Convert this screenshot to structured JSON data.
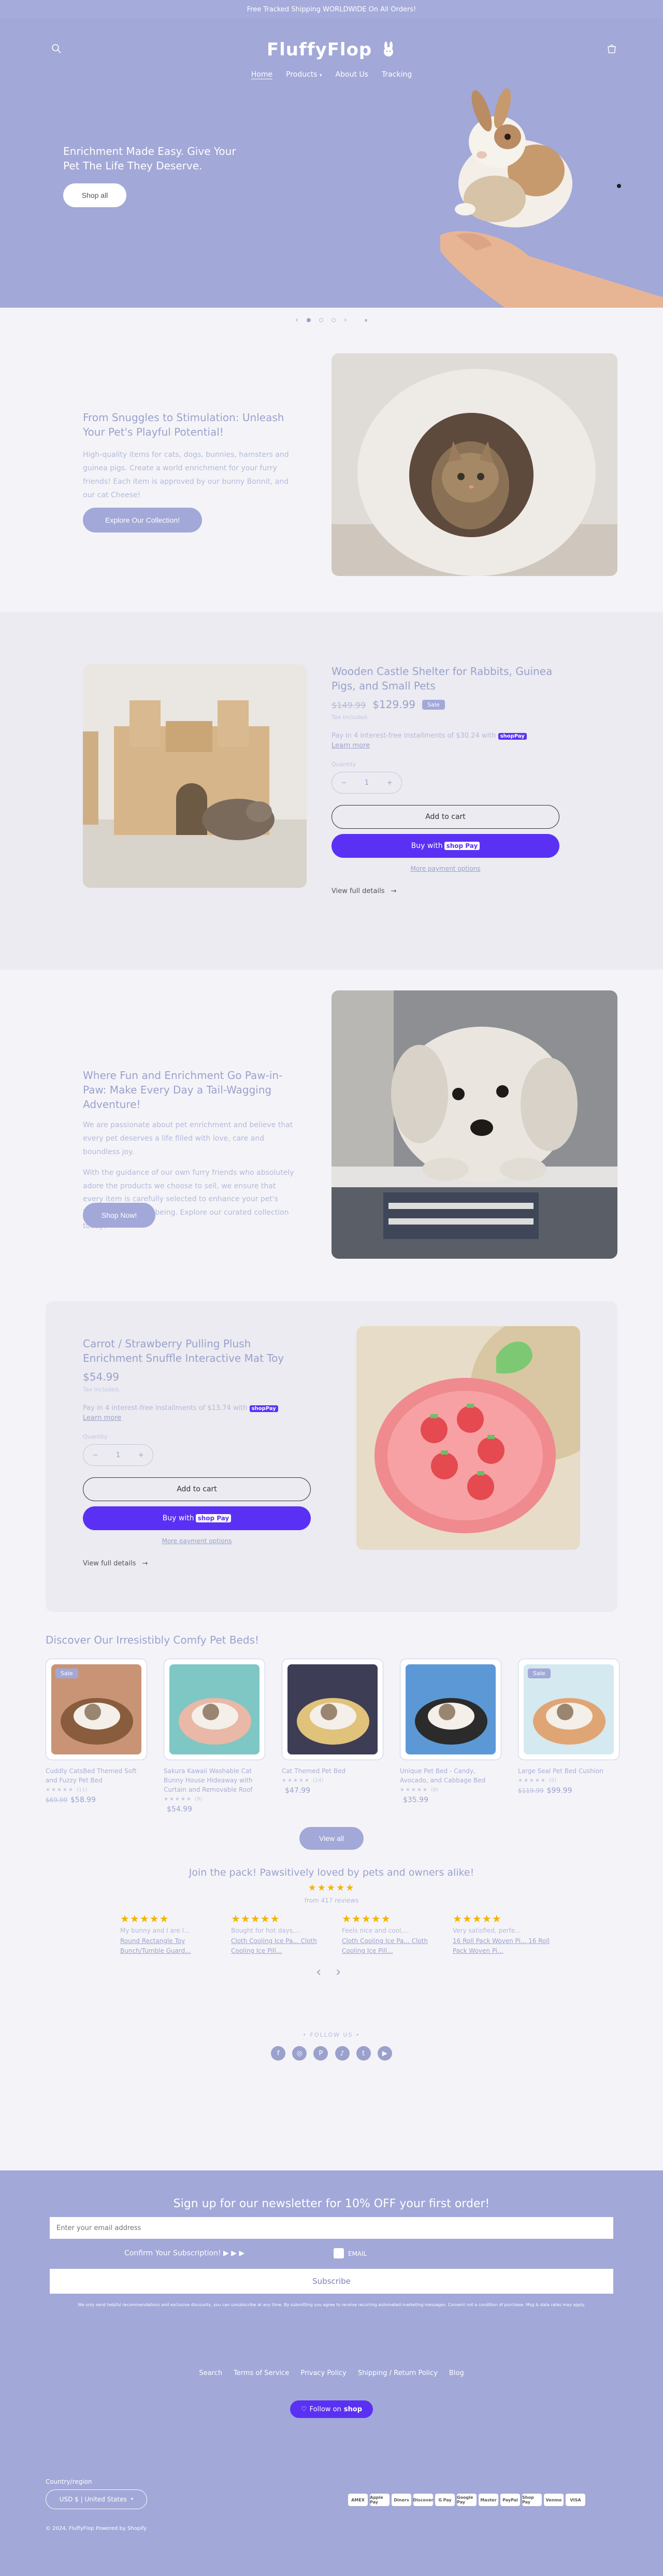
{
  "announcement": "Free Tracked Shipping WORLDWIDE On All Orders!",
  "brand": "FluffyFlop",
  "nav": [
    "Home",
    "Products",
    "About Us",
    "Tracking"
  ],
  "hero": {
    "heading": "Enrichment Made Easy. Give Your Pet The Life They Deserve.",
    "cta": "Shop all"
  },
  "slider": {
    "prev": "‹",
    "next": "›",
    "pause": "⏸"
  },
  "intro": {
    "heading": "From Snuggles to Stimulation: Unleash Your Pet's Playful Potential!",
    "body": "High-quality items for cats, dogs, bunnies, hamsters and guinea pigs. Create a world enrichment for your furry friends! Each item is approved by our bunny Bonnit, and our cat Cheese!",
    "cta": "Explore Our Collection!"
  },
  "featured1": {
    "title": "Wooden Castle Shelter for Rabbits, Guinea Pigs, and Small Pets",
    "price_old": "$149.99",
    "price": "$129.99",
    "badge": "Sale",
    "tax": "Tax included.",
    "installments": "Pay in 4 interest-free installments of $30.24 with",
    "learn": "Learn more",
    "qty_label": "Quantity",
    "qty": "1",
    "minus": "−",
    "plus": "+",
    "add": "Add to cart",
    "buy": "Buy with",
    "shop_pay": "shop Pay",
    "more": "More payment options",
    "details": "View full details"
  },
  "about": {
    "heading": "Where Fun and Enrichment Go Paw-in-Paw: Make Every Day a Tail-Wagging Adventure!",
    "p1": "We are passionate about pet enrichment and believe that every pet deserves a life filled with love, care and boundless joy.",
    "p2": "With the guidance of our own furry friends who absolutely adore the products we choose to sell, we ensure that every item is carefully selected to enhance your pet's happiness and well-being. Explore our curated collection today!",
    "cta": "Shop Now!"
  },
  "featured2": {
    "title": "Carrot / Strawberry Pulling Plush Enrichment Snuffle Interactive Mat Toy",
    "price": "$54.99",
    "tax": "Tax included.",
    "installments": "Pay in 4 interest-free installments of $13.74 with",
    "learn": "Learn more",
    "qty_label": "Quantity",
    "qty": "1",
    "minus": "−",
    "plus": "+",
    "add": "Add to cart",
    "buy": "Buy with",
    "shop_pay": "shop Pay",
    "more": "More payment options",
    "details": "View full details"
  },
  "collection": {
    "heading": "Discover Our Irresistibly Comfy Pet Beds!",
    "view_all": "View all",
    "products": [
      {
        "title": "Cuddly CatsBed Themed Soft and Fuzzy Pet Bed",
        "stars": "★★★★★",
        "count": "(11)",
        "price_old": "$69.99",
        "price": "$58.99",
        "badge": "Sale"
      },
      {
        "title": "Sakura Kawaii Washable Cat Bunny House Hideaway with Curtain and Removable Roof",
        "stars": "★★★★★",
        "count": "(9)",
        "price_old": "",
        "price": "$54.99",
        "badge": ""
      },
      {
        "title": "Cat Themed Pet Bed",
        "stars": "★★★★★",
        "count": "(14)",
        "price_old": "",
        "price": "$47.99",
        "badge": ""
      },
      {
        "title": "Unique Pet Bed - Candy, Avocado, and Cabbage Bed",
        "stars": "★★★★★",
        "count": "(8)",
        "price_old": "",
        "price": "$35.99",
        "badge": ""
      },
      {
        "title": "Large Seal Pet Bed Cushion",
        "stars": "★★★★★",
        "count": "(5)",
        "price_old": "$119.99",
        "price": "$99.99",
        "badge": "Sale"
      }
    ]
  },
  "reviews": {
    "heading": "Join the pack! Pawsitively loved by pets and owners alike!",
    "stars": "★★★★★",
    "sub": "from 417 reviews",
    "items": [
      {
        "stars": "★★★★★",
        "text": "My bunny and I are l...",
        "link": "Round Rectangle Toy Bunch/Tumble Guard..."
      },
      {
        "stars": "★★★★★",
        "text": "Bought for hot days,...",
        "link": "Cloth Cooling Ice Pa... Cloth Cooling Ice Pill..."
      },
      {
        "stars": "★★★★★",
        "text": "Feels nice and cool,...",
        "link": "Cloth Cooling Ice Pa... Cloth Cooling Ice Pill..."
      },
      {
        "stars": "★★★★★",
        "text": "Very satisfied, perfe...",
        "link": "16 Roll Pack Woven Pi... 16 Roll Pack Woven Pi..."
      }
    ],
    "prev": "‹",
    "next": "›"
  },
  "follow": {
    "label": "FOLLOW US",
    "icons": [
      "facebook-icon",
      "instagram-icon",
      "pinterest-icon",
      "tiktok-icon",
      "twitter-icon",
      "youtube-icon"
    ]
  },
  "newsletter": {
    "heading": "Sign up for our newsletter for 10% OFF your first order!",
    "email_placeholder": "Enter your email address",
    "confirm": "Confirm Your Subscription! ▶ ▶ ▶",
    "email_label": "EMAIL",
    "subscribe": "Subscribe",
    "legal": "We only send helpful recommendations and exclusive discounts, you can unsubscribe at any time. By submitting you agree to receive recurring automated marketing messages. Consent not a condition of purchase. Msg & data rates may apply."
  },
  "footer": {
    "links": [
      "Search",
      "Terms of Service",
      "Privacy Policy",
      "Shipping / Return Policy",
      "Blog"
    ],
    "follow_shop": "Follow on",
    "follow_shop_brand": "shop",
    "country_label": "Country/region",
    "country": "USD $ | United States",
    "copyright": "© 2024, FluffyFlop Powered by Shopify",
    "payments": [
      "AMEX",
      "Apple Pay",
      "Diners",
      "Discover",
      "G Pay",
      "Google Pay",
      "Master",
      "PayPal",
      "Shop Pay",
      "Venmo",
      "VISA"
    ]
  },
  "colors": {
    "periwinkle": "#a2a8d8",
    "shop_pay": "#5a31f4",
    "star": "#f5b301"
  }
}
